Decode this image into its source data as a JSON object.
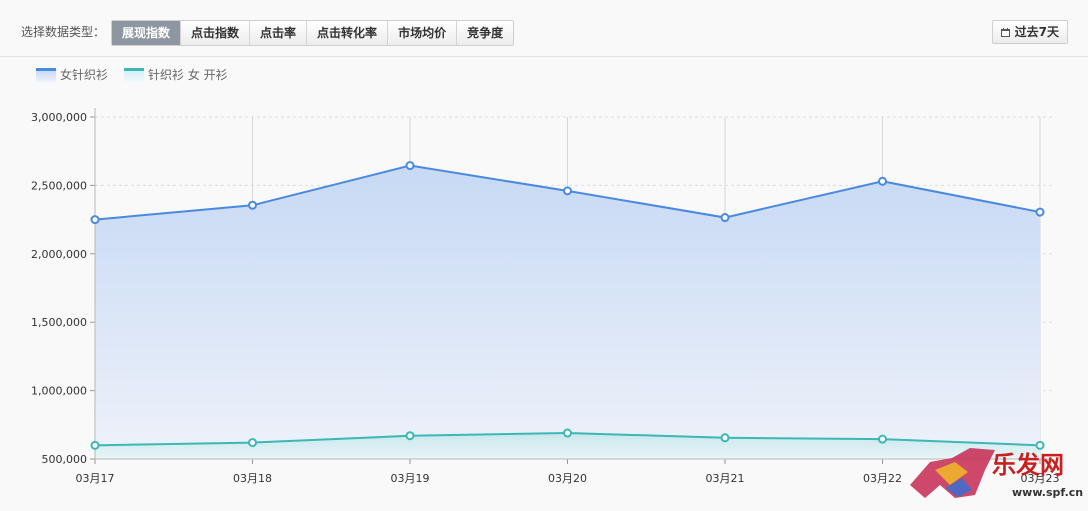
{
  "toolbar": {
    "data_type_label": "选择数据类型：",
    "tabs": [
      {
        "label": "展现指数",
        "active": true
      },
      {
        "label": "点击指数",
        "active": false
      },
      {
        "label": "点击率",
        "active": false
      },
      {
        "label": "点击转化率",
        "active": false
      },
      {
        "label": "市场均价",
        "active": false
      },
      {
        "label": "竞争度",
        "active": false
      }
    ],
    "range_button": {
      "label": "过去7天",
      "icon": "calendar-icon"
    }
  },
  "chart_data": {
    "type": "area",
    "categories": [
      "03月17",
      "03月18",
      "03月19",
      "03月20",
      "03月21",
      "03月22",
      "03月23"
    ],
    "series": [
      {
        "name": "女针织衫",
        "color": "#4a89e0",
        "values": [
          2250000,
          2355000,
          2645000,
          2460000,
          2265000,
          2530000,
          2305000
        ]
      },
      {
        "name": "针织衫 女 开衫",
        "color": "#3bb8b5",
        "values": [
          600000,
          620000,
          670000,
          690000,
          655000,
          645000,
          600000
        ]
      }
    ],
    "y_ticks": [
      "500,000",
      "1,000,000",
      "1,500,000",
      "2,000,000",
      "2,500,000",
      "3,000,000"
    ],
    "ylim": [
      500000,
      3000000
    ],
    "legend_position": "top-left",
    "grid": true
  },
  "watermark": {
    "text": "乐发网",
    "url_text": "www.spf.cn"
  }
}
